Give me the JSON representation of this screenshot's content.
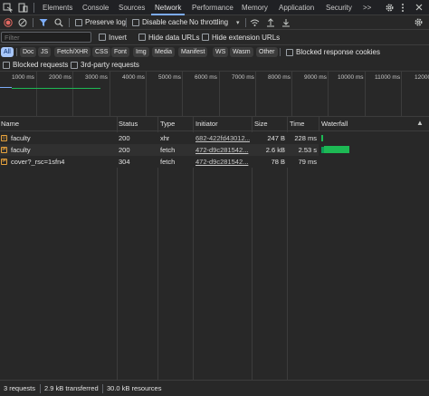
{
  "tabs": [
    {
      "label": "Elements"
    },
    {
      "label": "Console"
    },
    {
      "label": "Sources"
    },
    {
      "label": "Network",
      "active": true
    },
    {
      "label": "Performance"
    },
    {
      "label": "Memory"
    },
    {
      "label": "Application"
    },
    {
      "label": "Security"
    }
  ],
  "tabs_more": ">>",
  "toolbar": {
    "preserve_log": "Preserve log",
    "disable_cache": "Disable cache",
    "throttling": "No throttling"
  },
  "filter": {
    "placeholder": "Filter",
    "invert": "Invert",
    "hide_data_urls": "Hide data URLs",
    "hide_extension_urls": "Hide extension URLs"
  },
  "type_filters": [
    "All",
    "Doc",
    "JS",
    "Fetch/XHR",
    "CSS",
    "Font",
    "Img",
    "Media",
    "Manifest",
    "WS",
    "Wasm",
    "Other"
  ],
  "blocked_response_cookies": "Blocked response cookies",
  "blocked_requests": "Blocked requests",
  "third_party_requests": "3rd-party requests",
  "timeline_ticks": [
    "1000 ms",
    "2000 ms",
    "3000 ms",
    "4000 ms",
    "5000 ms",
    "6000 ms",
    "7000 ms",
    "8000 ms",
    "9000 ms",
    "10000 ms",
    "11000 ms",
    "12000"
  ],
  "columns": {
    "name": "Name",
    "status": "Status",
    "type": "Type",
    "initiator": "Initiator",
    "size": "Size",
    "time": "Time",
    "waterfall": "Waterfall"
  },
  "requests": [
    {
      "name": "faculty",
      "status": "200",
      "type": "xhr",
      "initiator": "682-422fd43012...",
      "size": "247 B",
      "time": "228 ms",
      "icon": "xhr-icon"
    },
    {
      "name": "faculty",
      "status": "200",
      "type": "fetch",
      "initiator": "472-d9c281542...",
      "size": "2.6 kB",
      "time": "2.53 s",
      "icon": "fetch-icon"
    },
    {
      "name": "cover?_rsc=1sfn4",
      "status": "304",
      "type": "fetch",
      "initiator": "472-d9c281542...",
      "size": "78 B",
      "time": "79 ms",
      "icon": "fetch-icon"
    }
  ],
  "status_bar": {
    "requests": "3 requests",
    "transferred": "2.9 kB transferred",
    "resources": "30.0 kB resources"
  },
  "colors": {
    "accent": "#7cacf8",
    "record": "#e46962",
    "waterfall_bar": "#1db954",
    "waterfall_wait": "#0f9d58"
  }
}
